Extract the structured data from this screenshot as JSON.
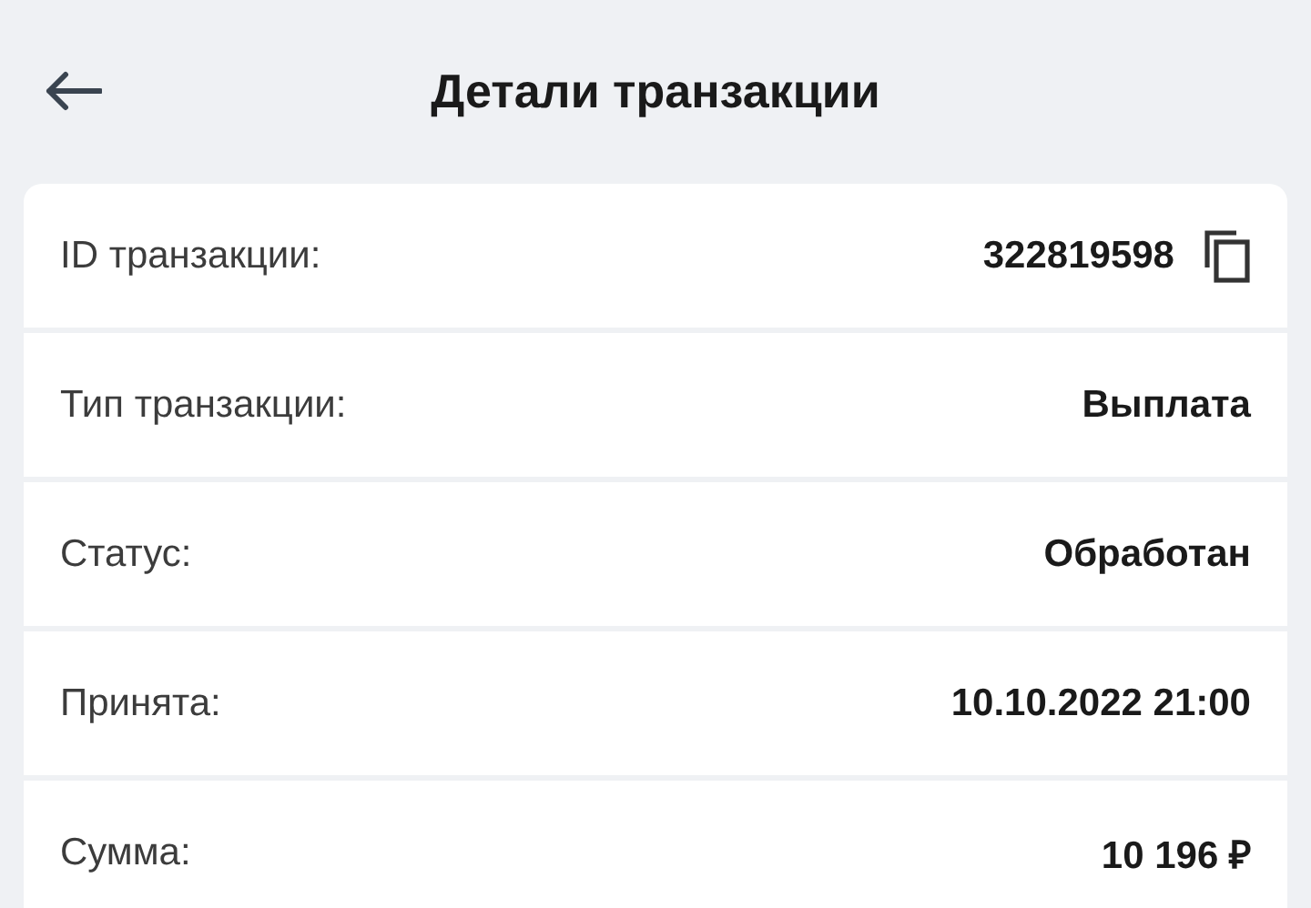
{
  "header": {
    "title": "Детали транзакции"
  },
  "rows": [
    {
      "label": "ID транзакции:",
      "value": "322819598",
      "copyable": true
    },
    {
      "label": "Тип транзакции:",
      "value": "Выплата",
      "copyable": false
    },
    {
      "label": "Статус:",
      "value": "Обработан",
      "copyable": false
    },
    {
      "label": "Принята:",
      "value": "10.10.2022 21:00",
      "copyable": false
    },
    {
      "label": "Сумма:",
      "value": "10 196 ₽",
      "copyable": false
    }
  ]
}
